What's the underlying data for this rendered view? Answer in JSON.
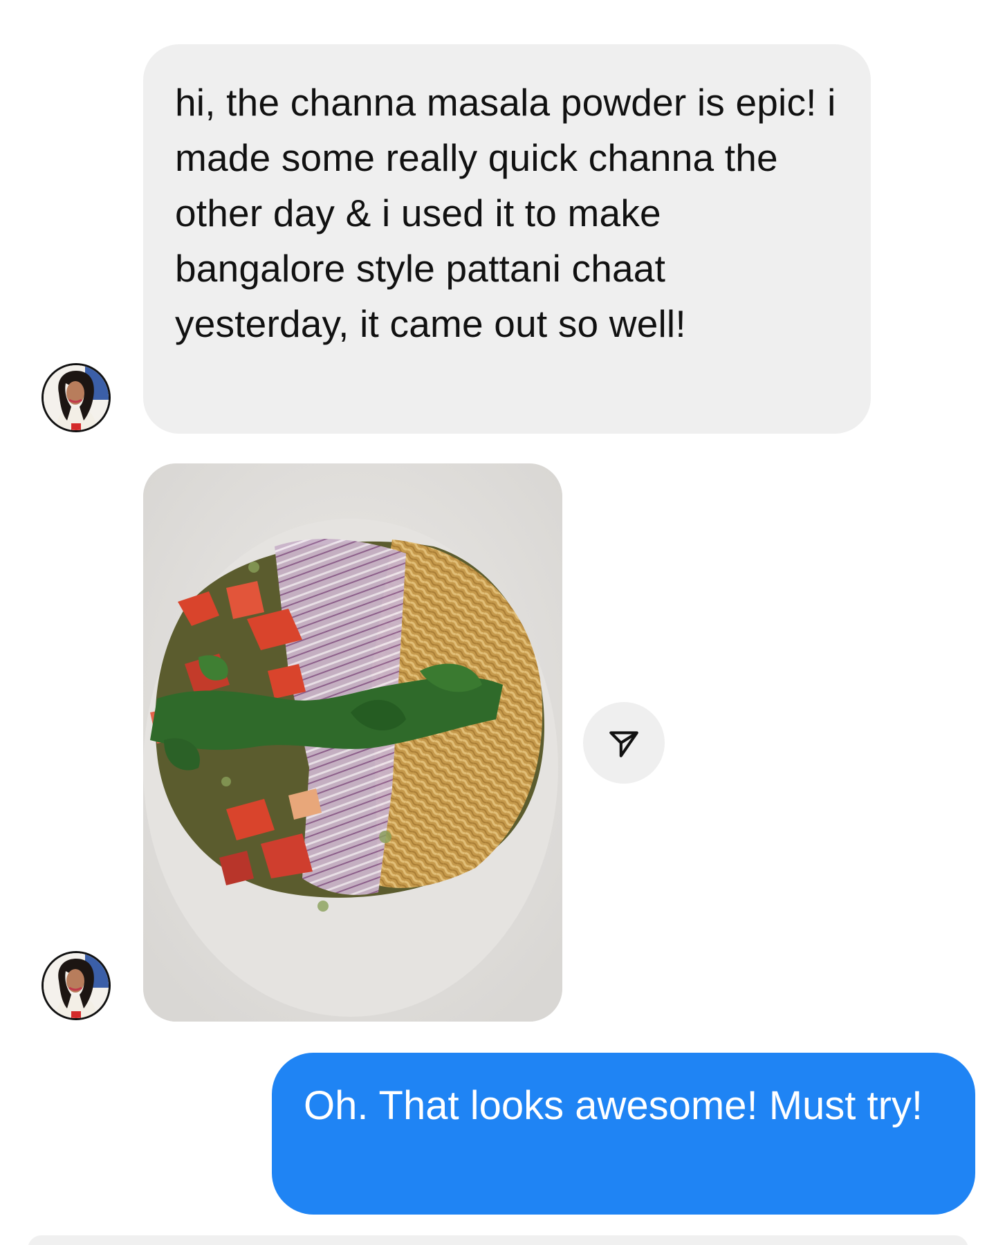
{
  "messages": {
    "incoming_text": "hi, the channa masala powder is epic! i made some really quick channa the other day & i used it to make bangalore style pattani chaat yesterday, it came out so well!",
    "outgoing_text": "Oh. That looks awesome! Must try!"
  },
  "icons": {
    "share": "paper-plane-icon",
    "avatar": "profile-avatar"
  },
  "colors": {
    "incoming_bubble": "#efefef",
    "outgoing_bubble": "#1f84f4",
    "outgoing_text": "#ffffff",
    "incoming_text": "#111111"
  }
}
